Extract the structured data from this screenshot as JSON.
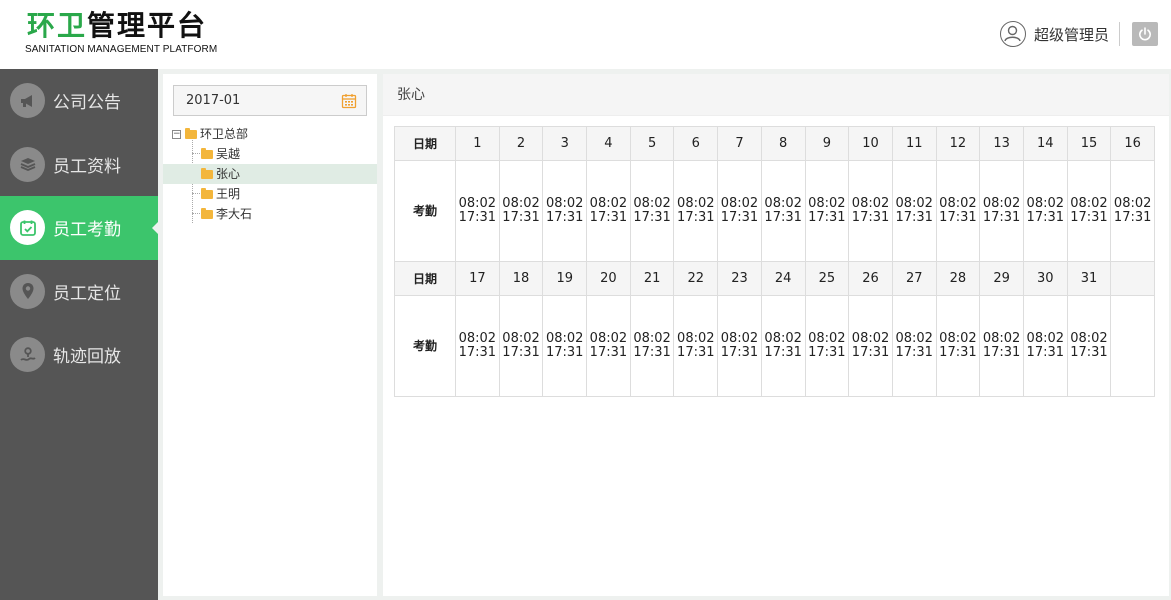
{
  "header": {
    "logo_green": "环卫",
    "logo_rest": "管理平台",
    "logo_sub": "SANITATION MANAGEMENT PLATFORM",
    "user_name": "超级管理员"
  },
  "sidebar": {
    "items": [
      {
        "label": "公司公告",
        "icon": "megaphone-icon"
      },
      {
        "label": "员工资料",
        "icon": "stack-icon"
      },
      {
        "label": "员工考勤",
        "icon": "calendar-check-icon",
        "active": true
      },
      {
        "label": "员工定位",
        "icon": "location-pin-icon"
      },
      {
        "label": "轨迹回放",
        "icon": "route-icon"
      }
    ]
  },
  "tree_panel": {
    "date_value": "2017-01",
    "root": "环卫总部",
    "children": [
      "吴越",
      "张心",
      "王明",
      "李大石"
    ],
    "selected": "张心"
  },
  "main": {
    "title": "张心",
    "row_label_date": "日期",
    "row_label_attendance": "考勤",
    "week1": {
      "days": [
        "1",
        "2",
        "3",
        "4",
        "5",
        "6",
        "7",
        "8",
        "9",
        "10",
        "11",
        "12",
        "13",
        "14",
        "15",
        "16"
      ],
      "times": [
        [
          "08:02",
          "17:31"
        ],
        [
          "08:02",
          "17:31"
        ],
        [
          "08:02",
          "17:31"
        ],
        [
          "08:02",
          "17:31"
        ],
        [
          "08:02",
          "17:31"
        ],
        [
          "08:02",
          "17:31"
        ],
        [
          "08:02",
          "17:31"
        ],
        [
          "08:02",
          "17:31"
        ],
        [
          "08:02",
          "17:31"
        ],
        [
          "08:02",
          "17:31"
        ],
        [
          "08:02",
          "17:31"
        ],
        [
          "08:02",
          "17:31"
        ],
        [
          "08:02",
          "17:31"
        ],
        [
          "08:02",
          "17:31"
        ],
        [
          "08:02",
          "17:31"
        ],
        [
          "08:02",
          "17:31"
        ]
      ]
    },
    "week2": {
      "days": [
        "17",
        "18",
        "19",
        "20",
        "21",
        "22",
        "23",
        "24",
        "25",
        "26",
        "27",
        "28",
        "29",
        "30",
        "31",
        ""
      ],
      "times": [
        [
          "08:02",
          "17:31"
        ],
        [
          "08:02",
          "17:31"
        ],
        [
          "08:02",
          "17:31"
        ],
        [
          "08:02",
          "17:31"
        ],
        [
          "08:02",
          "17:31"
        ],
        [
          "08:02",
          "17:31"
        ],
        [
          "08:02",
          "17:31"
        ],
        [
          "08:02",
          "17:31"
        ],
        [
          "08:02",
          "17:31"
        ],
        [
          "08:02",
          "17:31"
        ],
        [
          "08:02",
          "17:31"
        ],
        [
          "08:02",
          "17:31"
        ],
        [
          "08:02",
          "17:31"
        ],
        [
          "08:02",
          "17:31"
        ],
        [
          "08:02",
          "17:31"
        ],
        [
          "",
          ""
        ]
      ]
    }
  },
  "colors": {
    "accent_green": "#3cc56c",
    "logo_green": "#2aa84a",
    "sidebar_bg": "#555555",
    "folder": "#f3b63c",
    "calendar_icon": "#f0a030"
  }
}
